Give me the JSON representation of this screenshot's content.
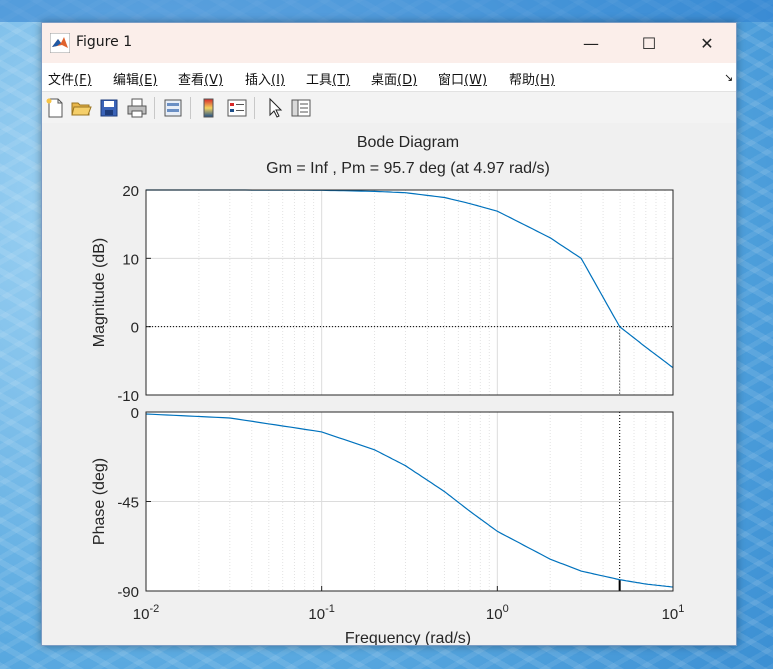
{
  "window": {
    "title": "Figure 1",
    "minimize_glyph": "—",
    "maximize_glyph": "☐",
    "close_glyph": "✕"
  },
  "menu": {
    "items": [
      {
        "label": "文件",
        "accel": "(F)"
      },
      {
        "label": "编辑",
        "accel": "(E)"
      },
      {
        "label": "查看",
        "accel": "(V)"
      },
      {
        "label": "插入",
        "accel": "(I)"
      },
      {
        "label": "工具",
        "accel": "(T)"
      },
      {
        "label": "桌面",
        "accel": "(D)"
      },
      {
        "label": "窗口",
        "accel": "(W)"
      },
      {
        "label": "帮助",
        "accel": "(H)"
      }
    ],
    "overflow_glyph": "↘"
  },
  "toolbar": {
    "icons": [
      "new-figure-icon",
      "open-file-icon",
      "save-icon",
      "print-icon",
      "link-plot-icon",
      "colorbar-icon",
      "legend-icon",
      "pointer-icon",
      "property-inspector-icon"
    ]
  },
  "chart_data": {
    "type": "line",
    "title": "Bode Diagram",
    "subtitle": "Gm = Inf ,  Pm = 95.7 deg (at 4.97 rad/s)",
    "xlabel": "Frequency  (rad/s)",
    "x_scale": "log",
    "xlim": [
      0.01,
      10
    ],
    "x_ticks": [
      {
        "base": "10",
        "exp": "-2"
      },
      {
        "base": "10",
        "exp": "-1"
      },
      {
        "base": "10",
        "exp": "0"
      },
      {
        "base": "10",
        "exp": "1"
      }
    ],
    "grid": true,
    "line_color": "#0072bd",
    "panels": [
      {
        "ylabel": "Magnitude (dB)",
        "ylim": [
          -10,
          20
        ],
        "y_ticks": [
          "20",
          "10",
          "0",
          "-10"
        ],
        "y_tick_values": [
          20,
          10,
          0,
          -10
        ],
        "reference_line_y": 0,
        "crossover_x": 4.97,
        "x": [
          0.01,
          0.03,
          0.1,
          0.2,
          0.3,
          0.5,
          0.7,
          1,
          2,
          3,
          4.97,
          7,
          10
        ],
        "y": [
          20.0,
          20.0,
          19.96,
          19.8,
          19.6,
          18.9,
          18.0,
          16.9,
          13.0,
          10.0,
          0.0,
          -3.0,
          -6.0
        ]
      },
      {
        "ylabel": "Phase (deg)",
        "ylim": [
          -90,
          0
        ],
        "y_ticks": [
          "0",
          "-45",
          "-90"
        ],
        "y_tick_values": [
          0,
          -45,
          -90
        ],
        "crossover_x": 4.97,
        "x": [
          0.01,
          0.03,
          0.1,
          0.2,
          0.3,
          0.5,
          0.7,
          1,
          2,
          3,
          4.97,
          7,
          10
        ],
        "y": [
          -1.0,
          -3.0,
          -10.0,
          -19.0,
          -27.0,
          -40.0,
          -50.0,
          -60.0,
          -74.0,
          -80.0,
          -84.3,
          -86.5,
          -88.0
        ]
      }
    ]
  }
}
